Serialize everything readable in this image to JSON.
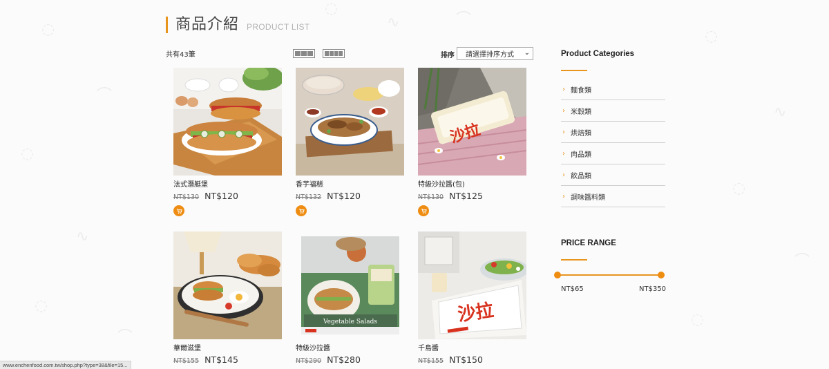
{
  "header": {
    "title": "商品介紹",
    "subtitle": "PRODUCT LIST"
  },
  "toolbar": {
    "count_text": "共有43筆",
    "sort_label": "排序",
    "sort_select_value": "請選擇排序方式"
  },
  "products": [
    {
      "name": "法式潛艇堡",
      "old_price": "NT$130",
      "price": "NT$120"
    },
    {
      "name": "香芋福糕",
      "old_price": "NT$132",
      "price": "NT$120"
    },
    {
      "name": "特級沙拉醬(包)",
      "old_price": "NT$130",
      "price": "NT$125"
    },
    {
      "name": "華爾滋堡",
      "old_price": "NT$155",
      "price": "NT$145"
    },
    {
      "name": "特級沙拉醬",
      "old_price": "NT$290",
      "price": "NT$280"
    },
    {
      "name": "千島醬",
      "old_price": "NT$155",
      "price": "NT$150"
    }
  ],
  "sidebar": {
    "categories_heading": "Product Categories",
    "categories": [
      {
        "label": "麵食類"
      },
      {
        "label": "米穀類"
      },
      {
        "label": "烘焙類"
      },
      {
        "label": "肉品類"
      },
      {
        "label": "飲品類"
      },
      {
        "label": "調味醬料類"
      }
    ],
    "price_heading": "PRICE RANGE",
    "price_min": "NT$65",
    "price_max": "NT$350"
  },
  "image_text": {
    "salad_bag": "沙拉",
    "vegetable_salads": "Vegetable Salads"
  },
  "status_url": "www.enchenfood.com.tw/shop.php?type=38&file=15...",
  "colors": {
    "accent": "#e8951e",
    "cart_button": "#ee8d12",
    "background": "#fbfbfb",
    "salad_red": "#d8321e"
  },
  "icons": {
    "cart": "cart-icon",
    "chevron": "chevron-right-icon",
    "grid3": "grid-3-view-icon",
    "grid4": "grid-4-view-icon"
  }
}
